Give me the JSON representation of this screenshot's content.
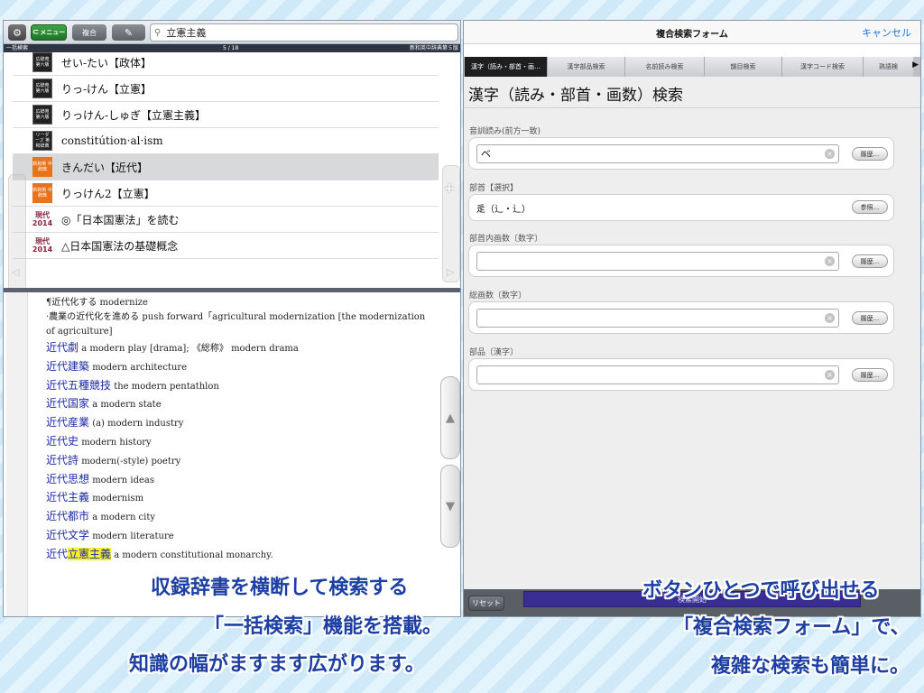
{
  "left": {
    "toolbar": {
      "settings_icon": "gear-icon",
      "menu_label": "メニュー",
      "combo_label": "複合",
      "pen_icon": "pen-icon",
      "search_value": "立憲主義"
    },
    "status": {
      "mode": "一括検索",
      "count": "5 / 18",
      "dictionary": "新和英中辞典第５版"
    },
    "results": [
      {
        "icon_type": "black",
        "icon_text": "広辞苑 第六版",
        "text": "せい-たい【政体】"
      },
      {
        "icon_type": "black",
        "icon_text": "広辞苑 第六版",
        "text": "りっ-けん【立憲】"
      },
      {
        "icon_type": "black",
        "icon_text": "広辞苑 第六版",
        "text": "りっけん-しゅぎ【立憲主義】"
      },
      {
        "icon_type": "black",
        "icon_text": "リーダーズ 英和辞典",
        "text": "constitútion·al·ism"
      },
      {
        "icon_type": "orange",
        "icon_text": "新和英 中辞典",
        "text": "きんだい【近代】",
        "selected": true
      },
      {
        "icon_type": "orange",
        "icon_text": "新和英 中辞典",
        "text": "りっけん2【立憲】"
      },
      {
        "icon_type": "gendai",
        "icon_text": "現代 2014",
        "text": "◎「日本国憲法」を読む"
      },
      {
        "icon_type": "gendai",
        "icon_text": "現代 2014",
        "text": "△日本国憲法の基礎概念"
      }
    ],
    "detail": {
      "intro": [
        "¶近代化する modernize",
        "·農業の近代化を進める push forward「agricultural modernization [the modernization",
        "of agriculture]"
      ],
      "entries": [
        {
          "jp": "近代劇",
          "hl": "",
          "en": " a modern play [drama]; 《総称》 modern drama"
        },
        {
          "jp": "近代建築",
          "hl": "",
          "en": " modern architecture"
        },
        {
          "jp": "近代五種競技",
          "hl": "",
          "en": " the modern pentathlon"
        },
        {
          "jp": "近代国家",
          "hl": "",
          "en": " a modern state"
        },
        {
          "jp": "近代産業",
          "hl": "",
          "en": " (a) modern industry"
        },
        {
          "jp": "近代史",
          "hl": "",
          "en": " modern history"
        },
        {
          "jp": "近代詩",
          "hl": "",
          "en": " modern(-style) poetry"
        },
        {
          "jp": "近代思想",
          "hl": "",
          "en": " modern ideas"
        },
        {
          "jp": "近代主義",
          "hl": "",
          "en": " modernism"
        },
        {
          "jp": "近代都市",
          "hl": "",
          "en": " a modern city"
        },
        {
          "jp": "近代文学",
          "hl": "",
          "en": " modern literature"
        },
        {
          "jp": "近代",
          "hl": "立憲主義",
          "en": " a modern constitutional monarchy."
        }
      ]
    }
  },
  "right": {
    "title": "複合検索フォーム",
    "cancel_label": "キャンセル",
    "tabs": [
      {
        "label": "漢字（読み・部首・画…",
        "active": true
      },
      {
        "label": "漢字部品検索",
        "active": false
      },
      {
        "label": "名前読み検索",
        "active": false
      },
      {
        "label": "韻目検索",
        "active": false
      },
      {
        "label": "漢字コード検索",
        "active": false
      },
      {
        "label": "熟語検",
        "active": false
      }
    ],
    "heading": "漢字（読み・部首・画数）検索",
    "fields": {
      "reading": {
        "label": "音訓読み(前方一致)",
        "value": "ベ",
        "history_label": "履歴..."
      },
      "radical": {
        "label": "部首【選択】",
        "value": "辵（辶・辶）",
        "ref_label": "参照..."
      },
      "inner_strokes": {
        "label": "部首内画数〔数字〕",
        "value": "",
        "history_label": "履歴..."
      },
      "total_strokes": {
        "label": "総画数〔数字〕",
        "value": "",
        "history_label": "履歴..."
      },
      "component": {
        "label": "部品〔漢字〕",
        "value": "",
        "history_label": "履歴..."
      }
    },
    "reset_label": "リセット",
    "search_start_label": "検索開始"
  },
  "captions": {
    "left": [
      "収録辞書を横断して検索する",
      "「一括検索」機能を搭載。",
      "知識の幅がますます広がります。"
    ],
    "right": [
      "ボタンひとつで呼び出せる",
      "「複合検索フォーム」で、",
      "複雑な検索も簡単に。"
    ]
  },
  "colors": {
    "accent_blue": "#1d3fa3",
    "link_blue": "#1677e8",
    "highlight_yellow": "#f6f12c",
    "menu_green": "#2a8a32",
    "search_button_purple": "#3a2d91"
  }
}
